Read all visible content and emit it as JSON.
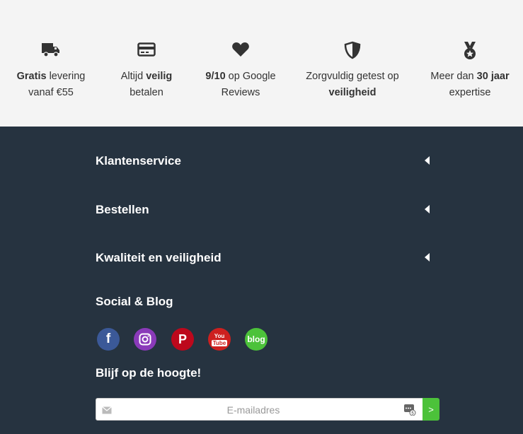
{
  "usps": [
    {
      "icon": "truck-icon",
      "l1a": "Gratis",
      "l1b": " levering",
      "l2a": "vanaf €55",
      "l2b": ""
    },
    {
      "icon": "credit-card-icon",
      "l1a": "Altijd ",
      "l1b": "veilig",
      "l2a": "betalen",
      "l2b": ""
    },
    {
      "icon": "heart-icon",
      "l1a": "9/10",
      "l1b": " op Google",
      "l2a": "Reviews",
      "l2b": ""
    },
    {
      "icon": "shield-icon",
      "l1a": "Zorgvuldig getest op",
      "l1b": "",
      "l2a": "veiligheid",
      "l2b": ""
    },
    {
      "icon": "medal-icon",
      "l1a": "Meer dan ",
      "l1b": "30 jaar",
      "l2a": "expertise",
      "l2b": ""
    }
  ],
  "accordion": [
    {
      "label": "Klantenservice"
    },
    {
      "label": "Bestellen"
    },
    {
      "label": "Kwaliteit en veiligheid"
    }
  ],
  "social_title": "Social & Blog",
  "social": [
    {
      "name": "facebook-icon",
      "text": "f",
      "color": "#3b5998"
    },
    {
      "name": "instagram-icon",
      "text": "",
      "color": "#8a3ab9"
    },
    {
      "name": "pinterest-icon",
      "text": "P",
      "color": "#bd081c"
    },
    {
      "name": "youtube-icon",
      "text_top": "You",
      "text_bottom": "Tube",
      "color": "#cd201f"
    },
    {
      "name": "blog-icon",
      "text": "blog",
      "color": "#4cc23a"
    }
  ],
  "newsletter": {
    "title": "Blijf op de hoogte!",
    "placeholder": "E-mailadres",
    "button": ">"
  }
}
